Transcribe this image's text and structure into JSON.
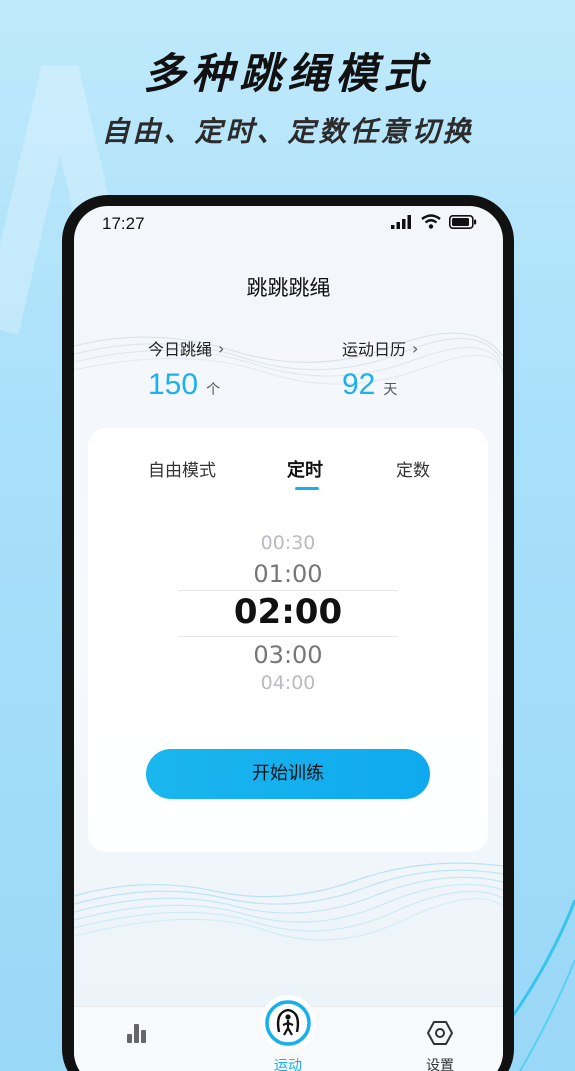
{
  "promo": {
    "headline": "多种跳绳模式",
    "subline": "自由、定时、定数任意切换"
  },
  "status_bar": {
    "time": "17:27",
    "icons": [
      "signal-icon",
      "wifi-icon",
      "battery-icon"
    ]
  },
  "app": {
    "title": "跳跳跳绳"
  },
  "stats": {
    "today": {
      "label": "今日跳绳",
      "value": "150",
      "unit": "个"
    },
    "calendar": {
      "label": "运动日历",
      "value": "92",
      "unit": "天"
    }
  },
  "mode_tabs": {
    "items": [
      {
        "label": "自由模式",
        "active": false
      },
      {
        "label": "定时",
        "active": true
      },
      {
        "label": "定数",
        "active": false
      }
    ]
  },
  "time_picker": {
    "options": [
      "00:30",
      "01:00",
      "02:00",
      "03:00",
      "04:00"
    ],
    "selected": "02:00"
  },
  "start_button": {
    "label": "开始训练"
  },
  "tab_bar": {
    "items": [
      {
        "label": "",
        "icon": "bar-chart-icon"
      },
      {
        "label": "运动",
        "icon": "jump-rope-icon",
        "active": true
      },
      {
        "label": "设置",
        "icon": "settings-hexagon-icon"
      }
    ]
  },
  "colors": {
    "accent": "#16b0ec",
    "background": "#a9e0fa"
  }
}
